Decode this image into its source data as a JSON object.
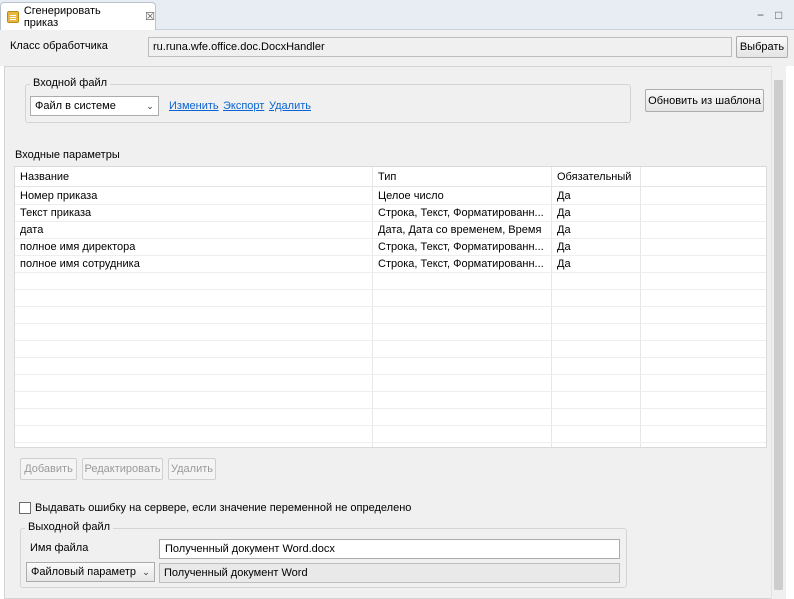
{
  "tab": {
    "title": "Сгенерировать приказ",
    "close": "☒"
  },
  "window_controls": {
    "minimize": "−",
    "maximize": "□"
  },
  "handler": {
    "label": "Класс обработчика",
    "value": "ru.runa.wfe.office.doc.DocxHandler",
    "choose_button": "Выбрать"
  },
  "input_file": {
    "group_title": "Входной файл",
    "source_select": "Файл в системе",
    "links": {
      "edit": "Изменить",
      "export": "Экспорт",
      "delete": "Удалить"
    },
    "update_button": "Обновить из шаблона"
  },
  "params": {
    "section_title": "Входные параметры",
    "columns": [
      "Название",
      "Тип",
      "Обязательный"
    ],
    "rows": [
      [
        "Номер приказа",
        "Целое число",
        "Да"
      ],
      [
        "Текст приказа",
        "Строка, Текст, Форматированн...",
        "Да"
      ],
      [
        "дата",
        "Дата, Дата со временем, Время",
        "Да"
      ],
      [
        "полное имя директора",
        "Строка, Текст, Форматированн...",
        "Да"
      ],
      [
        "полное имя сотрудника",
        "Строка, Текст, Форматированн...",
        "Да"
      ]
    ],
    "buttons": {
      "add": "Добавить",
      "edit": "Редактировать",
      "delete": "Удалить"
    }
  },
  "error_checkbox": {
    "label": "Выдавать ошибку на сервере, если значение переменной не определено",
    "checked": false
  },
  "output_file": {
    "group_title": "Выходной файл",
    "filename_label": "Имя файла",
    "filename_value": "Полученный документ Word.docx",
    "param_select": "Файловый параметр",
    "param_value": "Полученный документ Word"
  },
  "colors": {
    "link": "#0b63d1",
    "panel_bg": "#f0f0f0",
    "tabbar_bg": "#e8edf3"
  }
}
